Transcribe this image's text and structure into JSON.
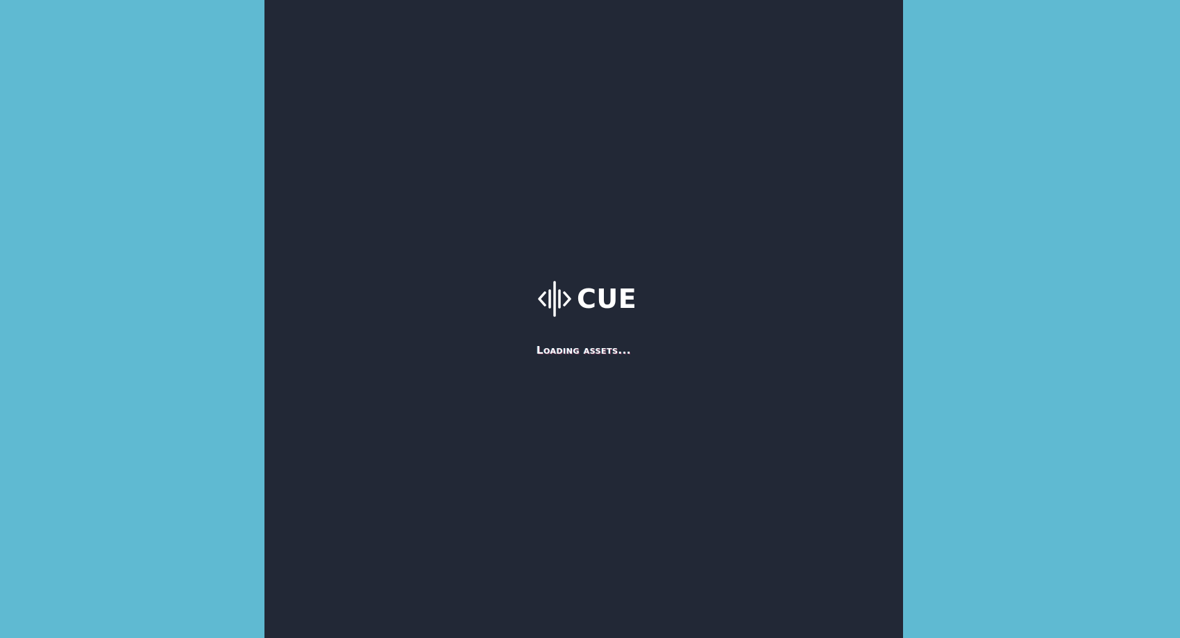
{
  "app": {
    "brand": "CUE",
    "logo_icon": "audio-waveform-code-icon"
  },
  "status": {
    "loading_text": "Loading assets..."
  },
  "colors": {
    "outer_background": "#5fbad2",
    "stage_background": "#222836",
    "foreground": "#ffffff"
  }
}
